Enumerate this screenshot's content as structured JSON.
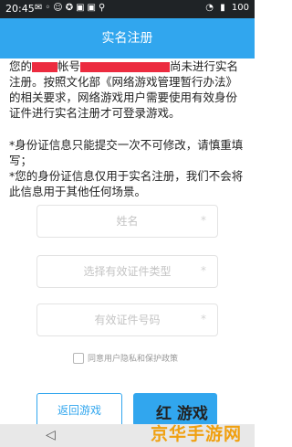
{
  "status_bar": {
    "time": "20:45",
    "battery": "100"
  },
  "header": {
    "title": "实名注册"
  },
  "intro": {
    "part1": "您的",
    "part2": "帐号",
    "part3": "尚未进行实名注册。按照文化部《网络游戏管理暂行办法》的相关要求，网络游戏用户需要使用有效身份证件进行实名注册才可登录游戏。"
  },
  "notes": [
    "*身份证信息只能提交一次不可修改，请慎重填写；",
    "*您的身份证信息仅用于实名注册，我们不会将此信息用于其他任何场景。"
  ],
  "form": {
    "name_placeholder": "姓名",
    "id_type_placeholder": "选择有效证件类型",
    "id_number_placeholder": "有效证件号码",
    "required_mark": "*"
  },
  "agreement": {
    "label": "同意用户隐私和保护政策"
  },
  "buttons": {
    "back_label": "返回游戏"
  },
  "watermark": {
    "line1": "红  游戏",
    "line2": "京华手游网"
  },
  "colors": {
    "accent": "#31a6ee",
    "redaction": "#ec2b3f"
  }
}
